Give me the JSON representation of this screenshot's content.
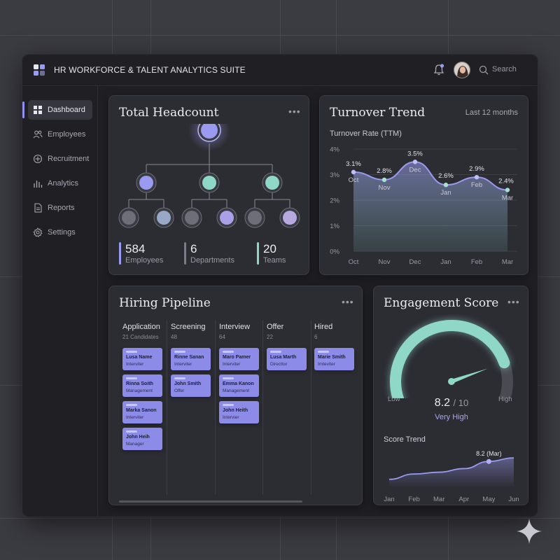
{
  "app": {
    "title": "HR WORKFORCE & TALENT ANALYTICS SUITE",
    "search_label": "Search"
  },
  "sidebar": {
    "items": [
      {
        "label": "Dashboard",
        "icon": "grid-icon",
        "active": true
      },
      {
        "label": "Employees",
        "icon": "users-icon",
        "active": false
      },
      {
        "label": "Recruitment",
        "icon": "target-icon",
        "active": false
      },
      {
        "label": "Analytics",
        "icon": "bar-chart-icon",
        "active": false
      },
      {
        "label": "Reports",
        "icon": "document-icon",
        "active": false
      },
      {
        "label": "Settings",
        "icon": "gear-icon",
        "active": false
      }
    ]
  },
  "headcount": {
    "title": "Total Headcount",
    "menu": "•••",
    "stats": [
      {
        "value": "584",
        "label": "Employees",
        "color": "#9a9af0"
      },
      {
        "value": "6",
        "label": "Departments",
        "color": "#7a7a88"
      },
      {
        "value": "20",
        "label": "Teams",
        "color": "#8fd8c8"
      }
    ],
    "colors": {
      "primary": "#9a9af0",
      "teal": "#8fd8c8",
      "grey": "#6e6e78",
      "steel": "#9aa8c8",
      "lilac": "#b8a8e0"
    }
  },
  "turnover": {
    "title": "Turnover Trend",
    "period": "Last 12 months",
    "chart_data": {
      "type": "area",
      "title": "Turnover Rate (TTM)",
      "x": [
        "Oct",
        "Nov",
        "Dec",
        "Jan",
        "Feb",
        "Mar"
      ],
      "values": [
        3.1,
        2.8,
        3.5,
        2.6,
        2.9,
        2.4
      ],
      "value_labels": [
        "3.1%",
        "2.8%",
        "3.5%",
        "2.6%",
        "2.9%",
        "2.4%"
      ],
      "ylim": [
        0,
        4
      ],
      "yticks": [
        "0%",
        "1%",
        "2%",
        "3%",
        "4%"
      ],
      "grid": true,
      "color": "#9a9af0"
    }
  },
  "pipeline": {
    "title": "Hiring Pipeline",
    "menu": "•••",
    "columns": [
      {
        "title": "Application",
        "count": "21 Candidates",
        "cards": [
          {
            "name": "Lusa Name",
            "role": "Interviter"
          },
          {
            "name": "Rinna Soith",
            "role": "Management"
          },
          {
            "name": "Marka Sanon",
            "role": "Interviter"
          },
          {
            "name": "John Heih",
            "role": "Manager"
          }
        ]
      },
      {
        "title": "Screening",
        "count": "48",
        "cards": [
          {
            "name": "Rinne Sanan",
            "role": "Interviter"
          },
          {
            "name": "John Smith",
            "role": "Offer"
          }
        ]
      },
      {
        "title": "Interview",
        "count": "64",
        "cards": [
          {
            "name": "Maro Pamer",
            "role": "Interviter"
          },
          {
            "name": "Emma Kanon",
            "role": "Management"
          },
          {
            "name": "John Heith",
            "role": "Intervier"
          }
        ]
      },
      {
        "title": "Offer",
        "count": "22",
        "cards": [
          {
            "name": "Lusa Marth",
            "role": "Directtor"
          }
        ]
      },
      {
        "title": "Hired",
        "count": "6",
        "cards": [
          {
            "name": "Marie Smith",
            "role": "Imteviter"
          }
        ]
      }
    ]
  },
  "engagement": {
    "title": "Engagement Score",
    "menu": "•••",
    "score": "8.2",
    "max": "/ 10",
    "rating": "Very High",
    "low_label": "Low",
    "high_label": "High",
    "gauge_fraction": 0.82,
    "colors": {
      "gauge": "#8fd8c8",
      "track": "#4a4a52",
      "rating": "#a8a8f5"
    },
    "trend": {
      "chart_data": {
        "type": "area",
        "title": "Score Trend",
        "x": [
          "Jan",
          "Feb",
          "Mar",
          "Apr",
          "May",
          "Jun"
        ],
        "values": [
          7.2,
          7.5,
          7.6,
          7.8,
          8.2,
          8.4
        ],
        "highlight": {
          "index": 4,
          "label": "8.2 (Mar)"
        },
        "color": "#9a9af0"
      }
    }
  }
}
